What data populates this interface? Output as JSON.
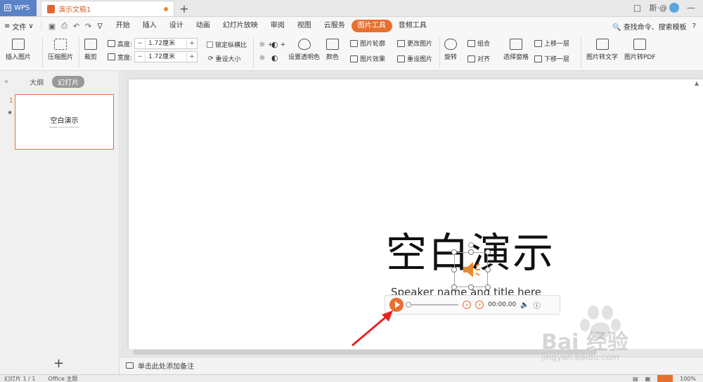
{
  "titlebar": {
    "app_tab": "WPS",
    "doc_tab": "演示文稿1",
    "user": "斯·@",
    "help": "?"
  },
  "menubar": {
    "file": "文件",
    "tabs": [
      "开始",
      "插入",
      "设计",
      "动画",
      "幻灯片放映",
      "审阅",
      "视图",
      "云服务",
      "图片工具",
      "音频工具"
    ],
    "active_tab": "图片工具",
    "search": "查找命令、搜索模板"
  },
  "ribbon": {
    "insert_picture": "插入图片",
    "compress": "压缩图片",
    "crop": "裁剪",
    "height_label": "高度:",
    "height_value": "1.72厘米",
    "width_label": "宽度:",
    "width_value": "1.72厘米",
    "lock_ratio": "锁定纵横比",
    "reset_size": "重设大小",
    "set_transparent": "设置透明色",
    "color": "颜色",
    "outline": "图片轮廓",
    "effect": "图片效果",
    "change": "更改图片",
    "reset": "重设图片",
    "rotate": "旋转",
    "group": "组合",
    "align": "对齐",
    "selection_pane": "选择窗格",
    "bring_forward": "上移一层",
    "send_backward": "下移一层",
    "to_text": "图片转文字",
    "to_pdf": "图片转PDF"
  },
  "left_panel": {
    "outline_tab": "大纲",
    "slides_tab": "幻灯片",
    "slide_number": "1",
    "thumb_title": "空白演示",
    "thumb_subtitle": "Speaker name and title here"
  },
  "slide": {
    "title": "空白演示",
    "subtitle": "Speaker name and title here",
    "time": "00:00.00"
  },
  "notes": {
    "placeholder": "单击此处添加备注"
  },
  "statusbar": {
    "slide_count": "幻灯片 1 / 1",
    "theme": "Office 主题",
    "zoom": "100%"
  },
  "watermark": {
    "brand": "Bai 经验",
    "url": "jingyan.baidu.com"
  }
}
